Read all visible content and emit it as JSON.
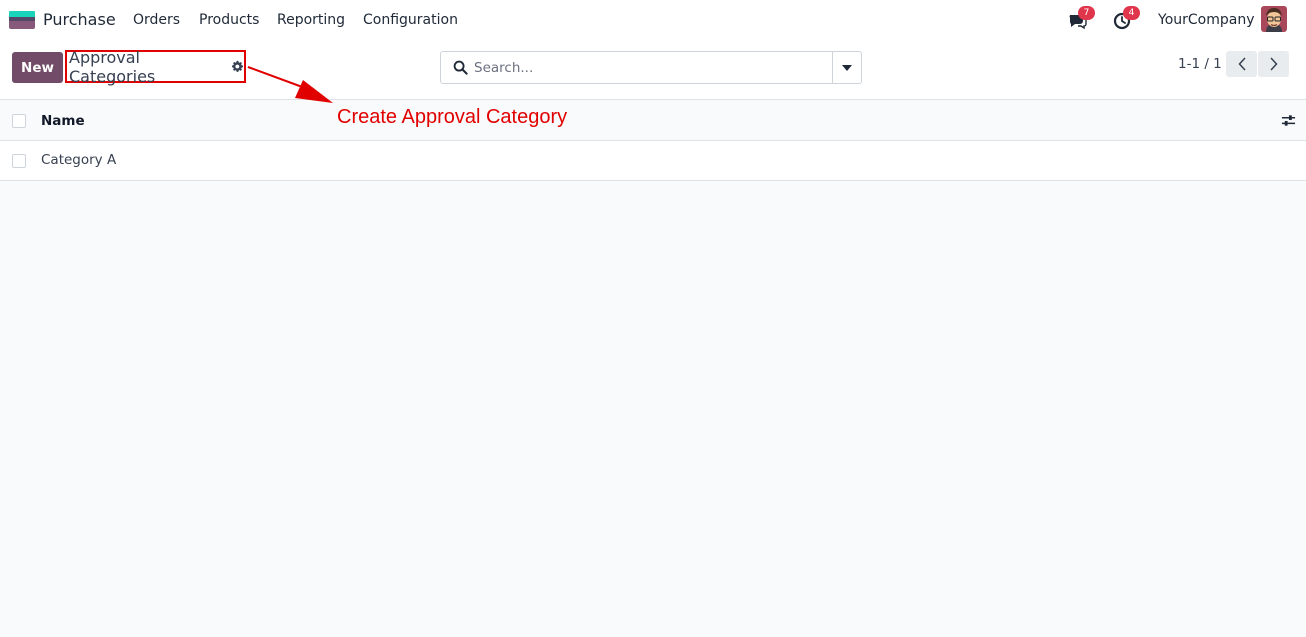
{
  "navbar": {
    "app_name": "Purchase",
    "menu": [
      "Orders",
      "Products",
      "Reporting",
      "Configuration"
    ],
    "messages_count": "7",
    "activities_count": "4",
    "company": "YourCompany"
  },
  "control_panel": {
    "new_label": "New",
    "breadcrumb_title": "Approval Categories",
    "search_placeholder": "Search...",
    "pager_value": "1-1 / 1"
  },
  "annotation": {
    "text": "Create Approval Category",
    "color": "#e10000"
  },
  "list": {
    "columns": [
      "Name"
    ],
    "rows": [
      {
        "name": "Category A"
      }
    ]
  },
  "colors": {
    "primary": "#714b67",
    "badge": "#e0364c",
    "annotation": "#e10000"
  }
}
